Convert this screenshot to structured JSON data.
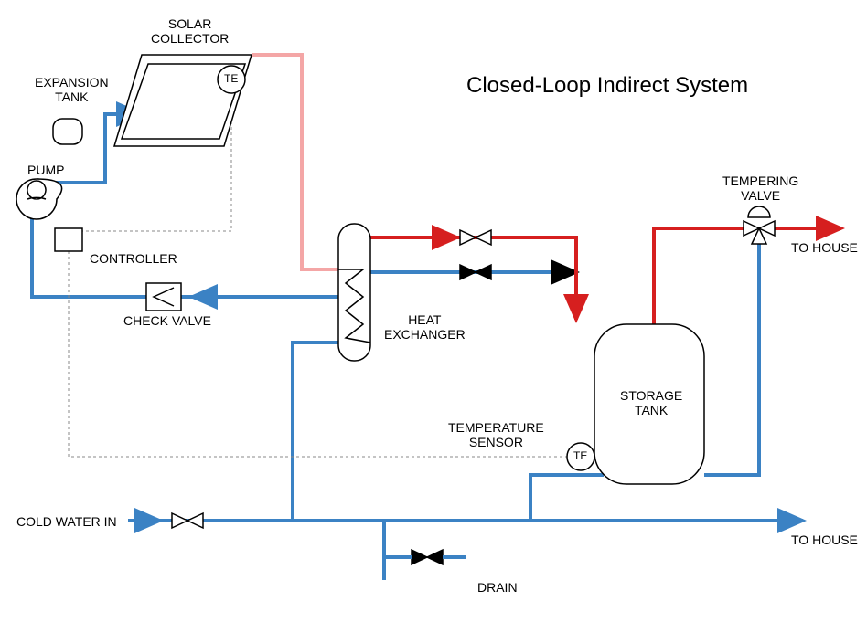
{
  "title": "Closed-Loop Indirect System",
  "labels": {
    "solar_collector": "SOLAR\nCOLLECTOR",
    "expansion_tank": "EXPANSION\nTANK",
    "pump": "PUMP",
    "controller": "CONTROLLER",
    "check_valve": "CHECK VALVE",
    "heat_exchanger": "HEAT\nEXCHANGER",
    "temperature_sensor": "TEMPERATURE\nSENSOR",
    "storage_tank": "STORAGE\nTANK",
    "tempering_valve": "TEMPERING\nVALVE",
    "cold_water_in": "COLD WATER IN",
    "drain": "DRAIN",
    "to_house_hot": "TO HOUSE",
    "to_house_cold": "TO HOUSE",
    "te1": "TE",
    "te2": "TE"
  },
  "colors": {
    "cold": "#3b82c4",
    "hot": "#d61f1f",
    "warm": "#f4a6a6",
    "stroke": "#000000",
    "dash": "#888888"
  }
}
